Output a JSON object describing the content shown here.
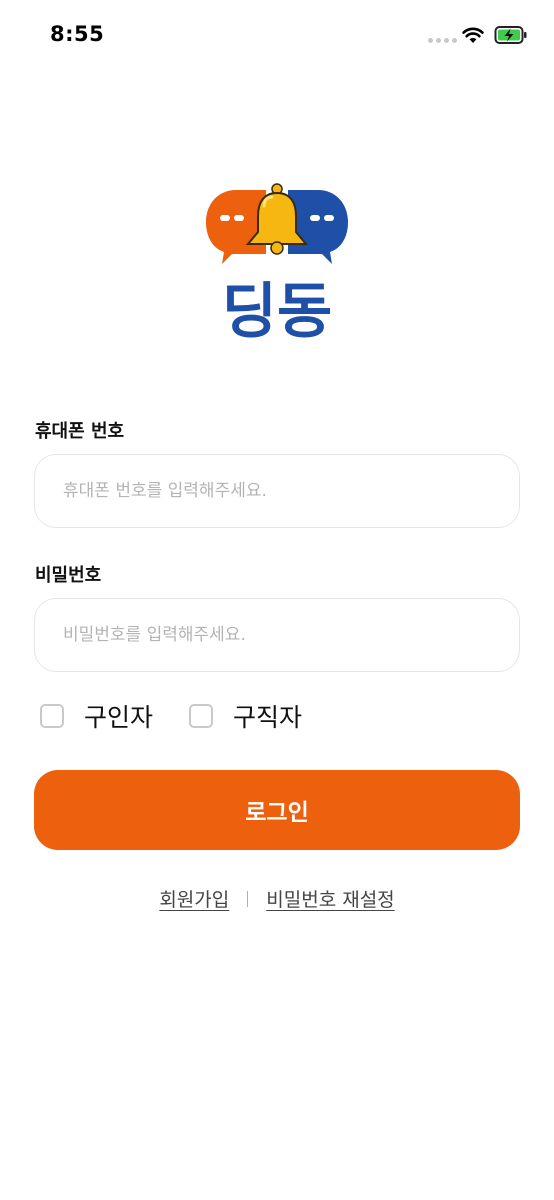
{
  "status_bar": {
    "time": "8:55"
  },
  "logo": {
    "text": "딩동"
  },
  "form": {
    "phone": {
      "label": "휴대폰 번호",
      "placeholder": "휴대폰 번호를 입력해주세요.",
      "value": ""
    },
    "password": {
      "label": "비밀번호",
      "placeholder": "비밀번호를 입력해주세요.",
      "value": ""
    },
    "user_type_options": [
      {
        "label": "구인자",
        "checked": false
      },
      {
        "label": "구직자",
        "checked": false
      }
    ]
  },
  "login_button": {
    "label": "로그인"
  },
  "links": {
    "signup": "회원가입",
    "reset_password": "비밀번호 재설정"
  },
  "colors": {
    "accent": "#ec600e",
    "logo_blue": "#1d50a6",
    "bell_yellow": "#f5b710"
  },
  "icons": [
    "wifi-icon",
    "battery-charging-icon",
    "bell-icon"
  ]
}
